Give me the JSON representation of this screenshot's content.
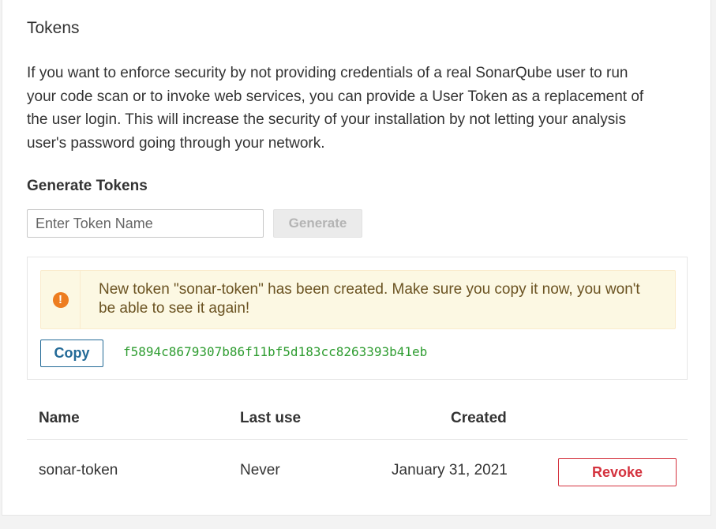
{
  "section": {
    "title": "Tokens",
    "description": "If you want to enforce security by not providing credentials of a real SonarQube user to run your code scan or to invoke web services, you can provide a User Token as a replacement of the user login. This will increase the security of your installation by not letting your analysis user's password going through your network."
  },
  "generate": {
    "title": "Generate Tokens",
    "input_value": "",
    "input_placeholder": "Enter Token Name",
    "button_label": "Generate"
  },
  "new_token": {
    "alert_icon": "exclamation-circle-icon",
    "alert_glyph": "!",
    "alert_color": "#ed7d20",
    "message": "New token \"sonar-token\" has been created. Make sure you copy it now, you won't be able to see it again!",
    "copy_label": "Copy",
    "token": "f5894c8679307b86f11bf5d183cc8263393b41eb"
  },
  "table": {
    "columns": [
      "Name",
      "Last use",
      "Created"
    ],
    "rows": [
      {
        "name": "sonar-token",
        "last_use": "Never",
        "created": "January 31, 2021",
        "action_label": "Revoke"
      }
    ]
  }
}
